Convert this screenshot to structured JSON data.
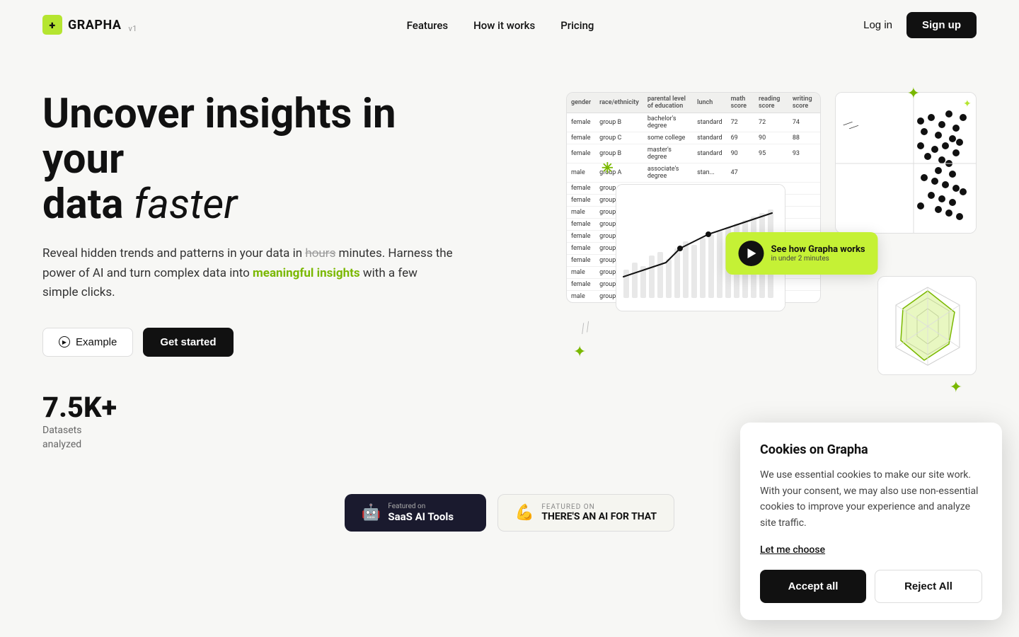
{
  "nav": {
    "logo_text": "GRAPHA",
    "logo_version": "v1",
    "logo_icon": "+",
    "links": [
      {
        "label": "Features",
        "href": "#"
      },
      {
        "label": "How it works",
        "href": "#"
      },
      {
        "label": "Pricing",
        "href": "#"
      }
    ],
    "login_label": "Log in",
    "signup_label": "Sign up"
  },
  "hero": {
    "title_line1": "Uncover insights in your",
    "title_line2_normal": "data ",
    "title_line2_italic": "faster",
    "desc_part1": "Reveal hidden trends and patterns in your data in ",
    "desc_strikethrough": "hours",
    "desc_part2": " minutes. Harness the power of AI and turn complex data into ",
    "desc_highlight": "meaningful insights",
    "desc_part3": " with a few simple clicks.",
    "btn_example": "Example",
    "btn_get_started": "Get started",
    "stat_number": "7.5K+",
    "stat_label_line1": "Datasets",
    "stat_label_line2": "analyzed"
  },
  "illustration": {
    "play_btn_main": "See how Grapha works",
    "play_btn_sub": "in under 2 minutes",
    "table": {
      "headers": [
        "gender",
        "race/ethnicity",
        "parental level of education",
        "lunch",
        "math score",
        "reading score",
        "writing score"
      ],
      "rows": [
        [
          "female",
          "group B",
          "bachelor's degree",
          "standard",
          "72",
          "72",
          "74"
        ],
        [
          "female",
          "group C",
          "some college",
          "standard",
          "69",
          "90",
          "88"
        ],
        [
          "female",
          "group B",
          "master's degree",
          "standard",
          "90",
          "95",
          "93"
        ],
        [
          "male",
          "group A",
          "associate's degree",
          "stan...",
          "47",
          "",
          ""
        ],
        [
          "female",
          "group C",
          "",
          "",
          "",
          "",
          ""
        ],
        [
          "female",
          "group B",
          "",
          "",
          "",
          "",
          ""
        ],
        [
          "male",
          "group B",
          "",
          "",
          "",
          "",
          ""
        ],
        [
          "female",
          "group B",
          "",
          "",
          "",
          "",
          ""
        ],
        [
          "female",
          "group D",
          "",
          "",
          "",
          "",
          ""
        ],
        [
          "female",
          "group B",
          "",
          "",
          "",
          "",
          ""
        ],
        [
          "female",
          "group C",
          "",
          "",
          "",
          "",
          ""
        ],
        [
          "male",
          "group D",
          "",
          "",
          "",
          "",
          ""
        ],
        [
          "female",
          "group B",
          "",
          "",
          "",
          "",
          ""
        ],
        [
          "male",
          "group C",
          "",
          "",
          "",
          "",
          ""
        ]
      ]
    }
  },
  "badges": [
    {
      "id": "saas",
      "icon": "🤖",
      "label_top": "Featured on",
      "label_main": "SaaS AI Tools"
    },
    {
      "id": "ai-for-that",
      "icon": "💪",
      "label_top": "FEATURED ON",
      "label_main": "THERE'S AN AI FOR THAT"
    }
  ],
  "cookie": {
    "title": "Cookies on Grapha",
    "body": "We use essential cookies to make our site work. With your consent, we may also use non-essential cookies to improve your experience and analyze site traffic.",
    "choose_label": "Let me choose",
    "accept_label": "Accept all",
    "reject_label": "Reject All"
  }
}
